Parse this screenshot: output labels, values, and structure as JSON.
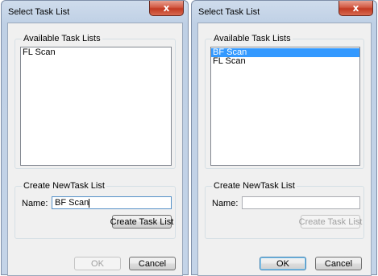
{
  "dialogs": [
    {
      "title": "Select Task List",
      "close_glyph": "x",
      "available_group_label": "Available Task Lists",
      "task_lists": [
        {
          "label": "FL Scan",
          "selected": false
        }
      ],
      "create_group_label": "Create NewTask List",
      "name_label": "Name:",
      "name_value": "BF Scan",
      "create_button": "Create Task List",
      "create_enabled": true,
      "ok_button": "OK",
      "ok_enabled": false,
      "cancel_button": "Cancel"
    },
    {
      "title": "Select Task List",
      "close_glyph": "x",
      "available_group_label": "Available Task Lists",
      "task_lists": [
        {
          "label": "BF Scan",
          "selected": true
        },
        {
          "label": "FL Scan",
          "selected": false
        }
      ],
      "create_group_label": "Create NewTask List",
      "name_label": "Name:",
      "name_value": "",
      "create_button": "Create Task List",
      "create_enabled": false,
      "ok_button": "OK",
      "ok_enabled": true,
      "cancel_button": "Cancel"
    }
  ],
  "colors": {
    "selection": "#3399ff",
    "close_button": "#c9442c",
    "frame": "#c4d4e8"
  }
}
